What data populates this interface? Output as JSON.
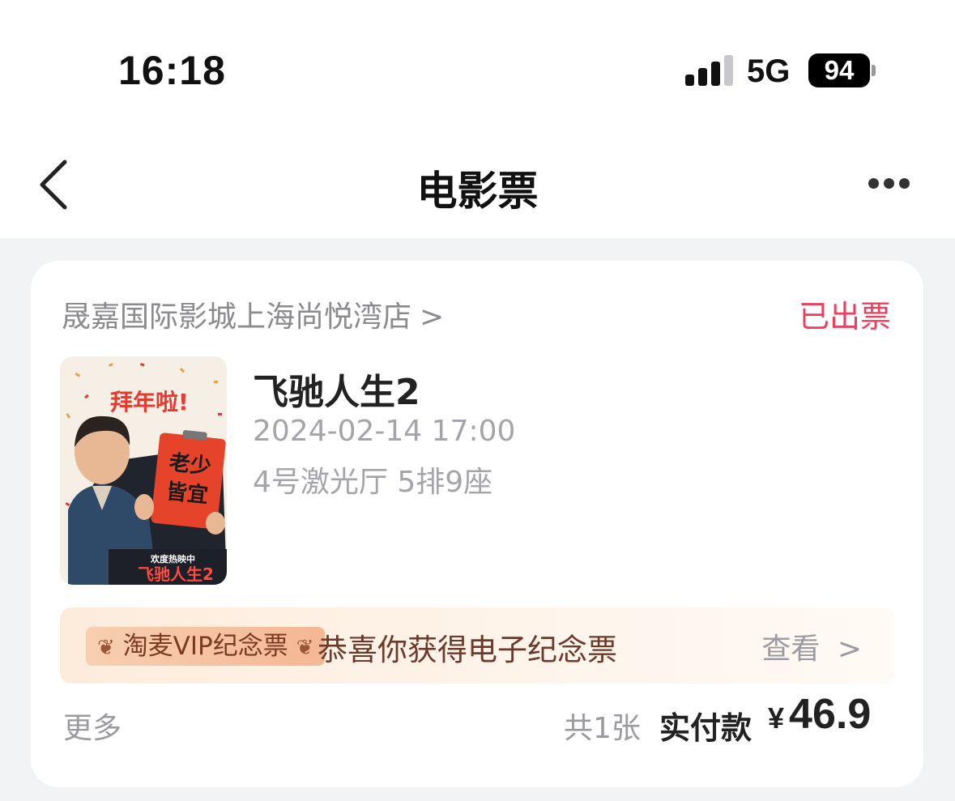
{
  "status_bar": {
    "time": "16:18",
    "network": "5G",
    "battery": "94"
  },
  "nav": {
    "title": "电影票",
    "back_icon": "chevron-left-icon",
    "more_icon": "more-dots-icon"
  },
  "order": {
    "cinema": "晟嘉国际影城上海尚悦湾店",
    "status": "已出票",
    "status_color": "#ef3e5c",
    "poster": {
      "headline": "拜年啦!",
      "sign_text": "老少皆宜",
      "footer": "欢度热映中",
      "title_art": "飞驰人生2"
    },
    "movie_title": "飞驰人生2",
    "datetime": "2024-02-14 17:00",
    "hall_seat": "4号激光厅 5排9座",
    "souvenir": {
      "badge": "淘麦VIP纪念票",
      "message": "恭喜你获得电子纪念票",
      "action": "查看"
    },
    "more_label": "更多",
    "ticket_count": "共1张",
    "paid_label": "实付款",
    "currency": "¥",
    "amount": "46.9"
  }
}
